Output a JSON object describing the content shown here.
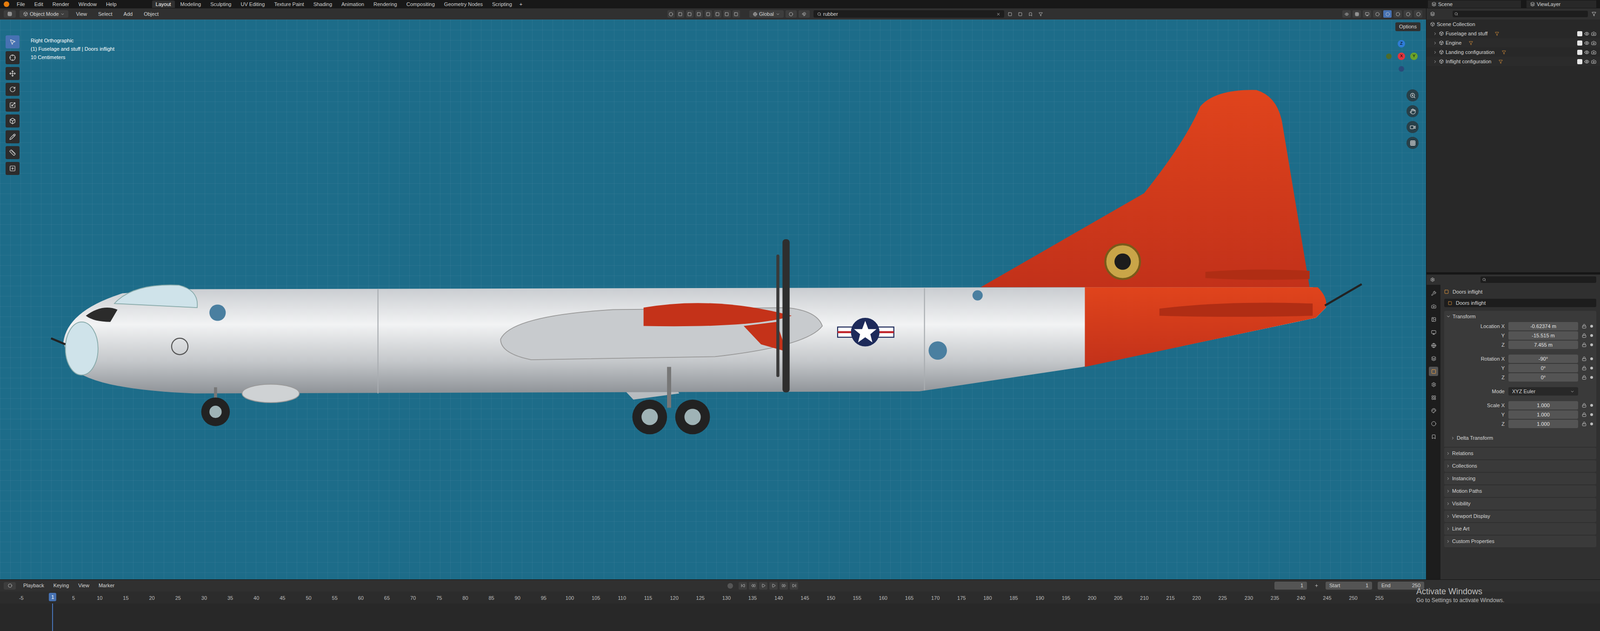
{
  "topbar": {
    "menus": [
      "File",
      "Edit",
      "Render",
      "Window",
      "Help"
    ],
    "workspaces": [
      {
        "label": "Layout",
        "selected": true
      },
      {
        "label": "Modeling",
        "selected": false
      },
      {
        "label": "Sculpting",
        "selected": false
      },
      {
        "label": "UV Editing",
        "selected": false
      },
      {
        "label": "Texture Paint",
        "selected": false
      },
      {
        "label": "Shading",
        "selected": false
      },
      {
        "label": "Animation",
        "selected": false
      },
      {
        "label": "Rendering",
        "selected": false
      },
      {
        "label": "Compositing",
        "selected": false
      },
      {
        "label": "Geometry Nodes",
        "selected": false
      },
      {
        "label": "Scripting",
        "selected": false
      }
    ],
    "add_tab": "+",
    "scene": "Scene",
    "view_layer": "ViewLayer"
  },
  "viewport": {
    "header": {
      "mode": "Object Mode",
      "menus": [
        "View",
        "Select",
        "Add",
        "Object"
      ],
      "orientation": "Global",
      "search": "rubber",
      "options": "Options"
    },
    "overlay": [
      "Right Orthographic",
      "(1) Fuselage and stuff | Doors inflight",
      "10 Centimeters"
    ],
    "gizmo": [
      {
        "label": "Z",
        "color": "#2f7cd6"
      },
      {
        "label": "Y",
        "color": "#6ba32b"
      },
      {
        "label": "X",
        "color": "#e0353f"
      }
    ],
    "tools": [
      {
        "selected": true
      },
      {
        "selected": false
      },
      {
        "selected": false
      },
      {
        "selected": false
      },
      {
        "selected": false
      },
      {
        "selected": false
      },
      {
        "selected": false
      },
      {
        "selected": false
      },
      {
        "selected": false
      }
    ]
  },
  "outliner": {
    "root": "Scene Collection",
    "items": [
      {
        "name": "Fuselage and stuff",
        "checked": true,
        "visible": true
      },
      {
        "name": "Engine",
        "checked": true,
        "visible": true
      },
      {
        "name": "Landing configuration",
        "checked": true,
        "visible": true
      },
      {
        "name": "Inflight configuration",
        "checked": true,
        "visible": true
      }
    ]
  },
  "properties": {
    "object": "Doors inflight",
    "data_block": "Doors inflight",
    "panel": "Transform",
    "rows": [
      {
        "label": "Location X",
        "value": "-0.62374 m",
        "kind": "field"
      },
      {
        "label": "Y",
        "value": "-15.515 m",
        "kind": "field"
      },
      {
        "label": "Z",
        "value": "7.455 m",
        "kind": "field"
      },
      {
        "label": "Rotation X",
        "value": "-90°",
        "kind": "field"
      },
      {
        "label": "Y",
        "value": "0°",
        "kind": "field"
      },
      {
        "label": "Z",
        "value": "0°",
        "kind": "field"
      },
      {
        "label": "Mode",
        "value": "XYZ Euler",
        "kind": "dropdown"
      },
      {
        "label": "Scale X",
        "value": "1.000",
        "kind": "field"
      },
      {
        "label": "Y",
        "value": "1.000",
        "kind": "field"
      },
      {
        "label": "Z",
        "value": "1.000",
        "kind": "field"
      }
    ],
    "delta": "Delta Transform",
    "subpanels": [
      "Relations",
      "Collections",
      "Instancing",
      "Motion Paths",
      "Visibility",
      "Viewport Display",
      "Line Art",
      "Custom Properties"
    ]
  },
  "timeline": {
    "menus": [
      "Playback",
      "Keying",
      "View",
      "Marker"
    ],
    "current_frame": "1",
    "start": {
      "label": "Start",
      "value": "1"
    },
    "end": {
      "label": "End",
      "value": "250"
    },
    "playhead": "1",
    "ruler": [
      "-5",
      "5",
      "10",
      "15",
      "20",
      "25",
      "30",
      "35",
      "40",
      "45",
      "50",
      "55",
      "60",
      "65",
      "70",
      "75",
      "80",
      "85",
      "90",
      "95",
      "100",
      "105",
      "110",
      "115",
      "120",
      "125",
      "130",
      "135",
      "140",
      "145",
      "150",
      "155",
      "160",
      "165",
      "170",
      "175",
      "180",
      "185",
      "190",
      "195",
      "200",
      "205",
      "210",
      "215",
      "220",
      "225",
      "230",
      "235",
      "240",
      "245",
      "250",
      "255"
    ]
  },
  "watermark": {
    "title": "Activate Windows",
    "subtitle": "Go to Settings to activate Windows."
  }
}
